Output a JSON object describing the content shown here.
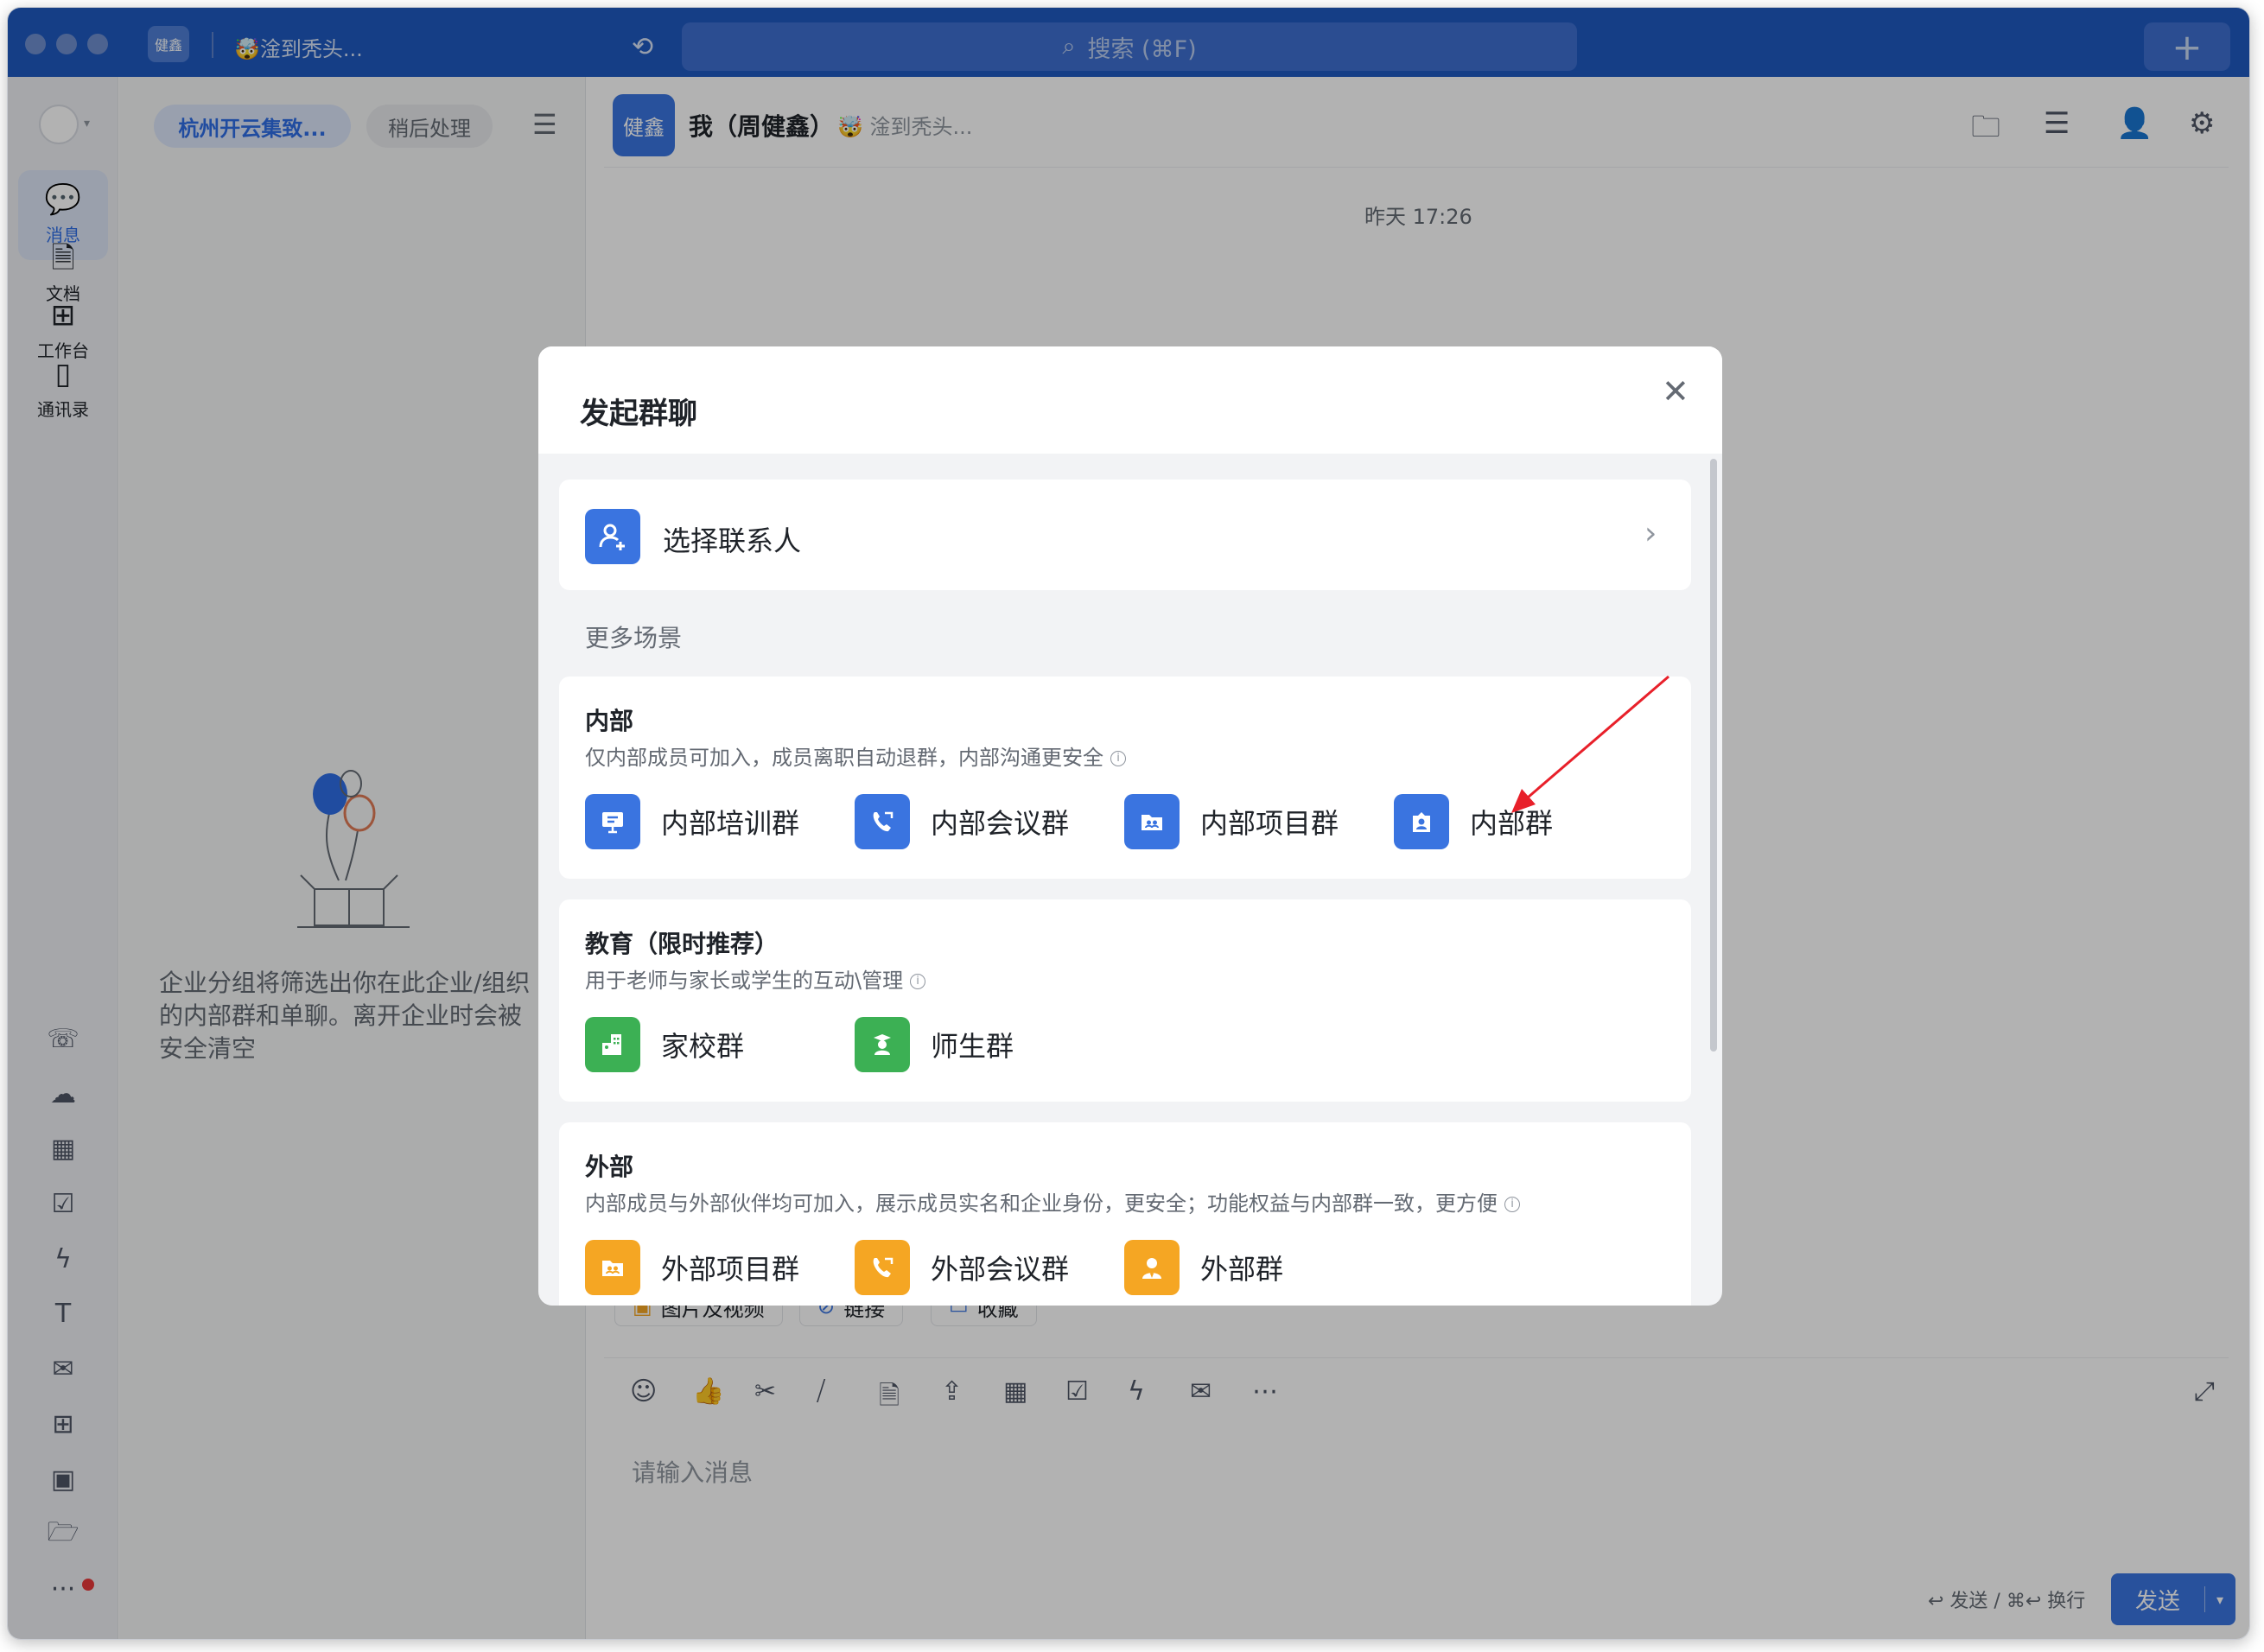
{
  "titlebar": {
    "avatar_text": "健鑫",
    "status": "🤯淦到秃头...",
    "search_placeholder": "搜索 (⌘F)",
    "plus": "+"
  },
  "rail": {
    "items": [
      {
        "label": "消息"
      },
      {
        "label": "文档"
      },
      {
        "label": "工作台"
      },
      {
        "label": "通讯录"
      }
    ],
    "more": "···"
  },
  "list": {
    "filter_active": "杭州开云集致...",
    "filter_other": "稍后处理",
    "empty_text": "企业分组将筛选出你在此企业/组织的内部群和单聊。离开企业时会被安全清空"
  },
  "chat": {
    "avatar_text": "健鑫",
    "name": "我（周健鑫）",
    "status": "🤯 淦到秃头...",
    "time": "昨天 17:26",
    "quick_actions": [
      "图片及视频",
      "链接",
      "收藏"
    ],
    "input_placeholder": "请输入消息",
    "send_hint": "↩ 发送 / ⌘↩ 换行",
    "send_label": "发送"
  },
  "modal": {
    "title": "发起群聊",
    "select_contacts": "选择联系人",
    "more_scenes": "更多场景",
    "sections": [
      {
        "title": "内部",
        "desc": "仅内部成员可加入，成员离职自动退群，内部沟通更安全",
        "options": [
          "内部培训群",
          "内部会议群",
          "内部项目群",
          "内部群"
        ]
      },
      {
        "title": "教育（限时推荐）",
        "desc": "用于老师与家长或学生的互动\\管理",
        "options": [
          "家校群",
          "师生群"
        ]
      },
      {
        "title": "外部",
        "desc": "内部成员与外部伙伴均可加入，展示成员实名和企业身份，更安全；功能权益与内部群一致，更方便",
        "options": [
          "外部项目群",
          "外部会议群",
          "外部群"
        ]
      }
    ]
  },
  "colors": {
    "titlebar": "#1f5ac0",
    "blue_icon": "#3a74e0",
    "green_icon": "#3cb054",
    "orange_icon": "#f5a623",
    "annotation_arrow": "#e8202a"
  }
}
